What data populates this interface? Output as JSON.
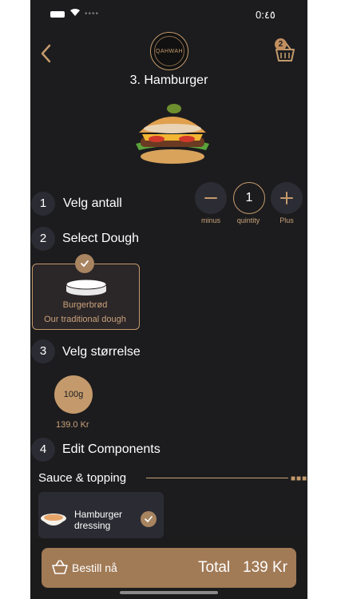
{
  "status": {
    "time": "0:٤٥"
  },
  "header": {
    "title": "3. Hamburger",
    "logo_text": "QAHWAH",
    "cart_count": "2"
  },
  "steps": [
    {
      "number": "1",
      "label": "Velg antall"
    },
    {
      "number": "2",
      "label": "Select Dough"
    },
    {
      "number": "3",
      "label": "Velg størrelse"
    },
    {
      "number": "4",
      "label": "Edit Components"
    }
  ],
  "quantity": {
    "minus_label": "minus",
    "value_label": "quintity",
    "plus_label": "Plus",
    "value": "1"
  },
  "dough": {
    "name": "Burgerbrød",
    "description": "Our traditional dough"
  },
  "size": {
    "value": "100g",
    "price": "139.0 Kr"
  },
  "components": {
    "section_title": "Sauce & topping",
    "items": [
      {
        "name": "Hamburger dressing"
      }
    ]
  },
  "order": {
    "button_label": "Bestill nå",
    "total_label": "Total",
    "total_value": "139 Kr"
  },
  "colors": {
    "accent": "#c49a6c",
    "background": "#1c1c1e",
    "button": "#a17a56"
  }
}
